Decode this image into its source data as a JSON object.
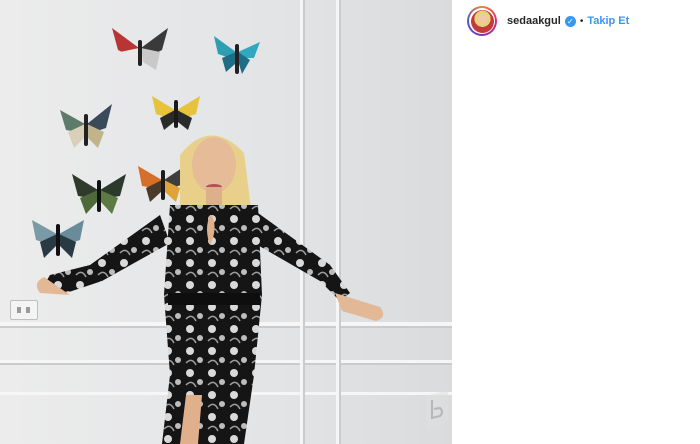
{
  "post": {
    "username": "sedaakgul",
    "separator": "•",
    "follow_label": "Takip Et",
    "verified_icon": "verified-badge-icon"
  },
  "colors": {
    "link_blue": "#3897f0",
    "text_dark": "#262626",
    "wall": "#e6e7e8"
  }
}
